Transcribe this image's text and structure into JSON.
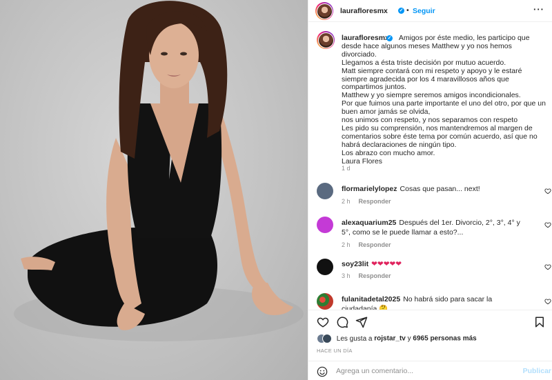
{
  "post": {
    "username": "lauraflooresmx",
    "follow_label": "Seguir",
    "more_label": "···",
    "caption": {
      "username": "laurafloresmx",
      "text": "Amigos por éste medio, les participo que desde hace algunos meses Matthew y yo nos hemos divorciado.\nLlegamos a ésta triste decisión por mutuo acuerdo.\nMatt siempre contará con mi respeto y apoyo y le estaré siempre agradecida por los 4 maravillosos años que compartimos juntos.\nMatthew y yo siempre seremos amigos incondicionales.\nPor que fuimos una parte importante el uno del otro, por que un buen amor jamás se olvida,\nnos unimos con respeto, y nos separamos con respeto\nLes pido su comprensión, nos mantendremos al margen de comentarios sobre éste tema por común acuerdo, así que no habrá declaraciones de ningún tipo.\nLos abrazo con mucho amor.\nLaura Flores",
      "time": "1 d"
    },
    "comments": [
      {
        "username": "flormarielylopez",
        "text": "Cosas que pasan... next!",
        "time": "2 h",
        "reply": "Responder",
        "avatar_color": "#5a6a80"
      },
      {
        "username": "alexaquarium25",
        "text": "Después del 1er. Divorcio, 2°, 3°, 4° y 5°, como se le puede llamar a esto?...",
        "time": "2 h",
        "reply": "Responder",
        "avatar_color": "#c43ad6"
      },
      {
        "username": "soy23lit",
        "text": "❤❤❤❤❤",
        "time": "3 h",
        "reply": "Responder",
        "avatar_color": "#111111"
      },
      {
        "username": "fulanitadetal2025",
        "text": "No habrá sido para sacar la ciudadanía 🤔",
        "time": "",
        "reply": "",
        "avatar_color": "#c0392b"
      }
    ],
    "likes": {
      "prefix": "Les gusta a",
      "user": "rojstar_tv",
      "connector": "y",
      "count": "6965 personas más"
    },
    "posted_ago": "HACE UN DÍA",
    "add_comment": {
      "placeholder": "Agrega un comentario...",
      "publish_label": "Publicar"
    }
  },
  "colors": {
    "accent": "#0095f6",
    "muted": "#8e8e8e",
    "publish_disabled": "#b2dffc"
  }
}
